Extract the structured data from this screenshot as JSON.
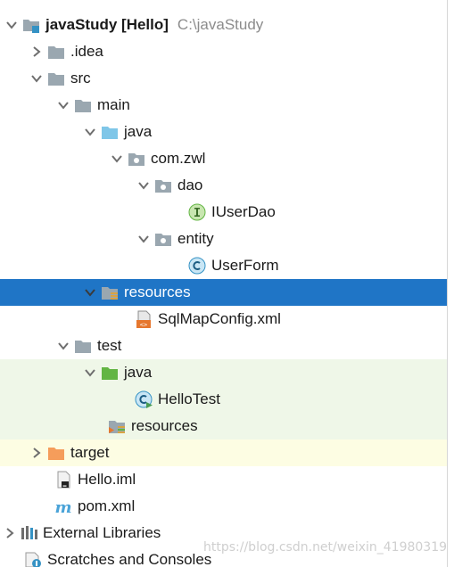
{
  "tree": {
    "rows": [
      {
        "label": "javaStudy [Hello]",
        "secondary": "C:\\javaStudy",
        "expanded": true,
        "icon": "module-folder-icon"
      },
      {
        "label": ".idea",
        "expanded": false,
        "icon": "folder-icon"
      },
      {
        "label": "src",
        "expanded": true,
        "icon": "folder-icon"
      },
      {
        "label": "main",
        "expanded": true,
        "icon": "folder-icon"
      },
      {
        "label": "java",
        "expanded": true,
        "icon": "source-root-folder-icon"
      },
      {
        "label": "com.zwl",
        "expanded": true,
        "icon": "package-icon"
      },
      {
        "label": "dao",
        "expanded": true,
        "icon": "package-icon"
      },
      {
        "label": "IUserDao",
        "icon": "interface-icon"
      },
      {
        "label": "entity",
        "expanded": true,
        "icon": "package-icon"
      },
      {
        "label": "UserForm",
        "icon": "class-icon"
      },
      {
        "label": "resources",
        "expanded": true,
        "selected": true,
        "icon": "resources-folder-icon"
      },
      {
        "label": "SqlMapConfig.xml",
        "icon": "xml-file-icon"
      },
      {
        "label": "test",
        "expanded": true,
        "icon": "folder-icon"
      },
      {
        "label": "java",
        "expanded": true,
        "icon": "test-source-folder-icon"
      },
      {
        "label": "HelloTest",
        "icon": "test-class-icon"
      },
      {
        "label": "resources",
        "icon": "test-resources-folder-icon"
      },
      {
        "label": "target",
        "expanded": false,
        "icon": "excluded-folder-icon"
      },
      {
        "label": "Hello.iml",
        "icon": "iml-file-icon"
      },
      {
        "label": "pom.xml",
        "icon": "maven-icon"
      },
      {
        "label": "External Libraries",
        "expanded": false,
        "icon": "libraries-icon"
      },
      {
        "label": "Scratches and Consoles",
        "icon": "scratches-icon"
      }
    ]
  },
  "watermark": "https://blog.csdn.net/weixin_41980319",
  "colors": {
    "selection": "#1f75c6",
    "test_background": "#eff7e8",
    "excluded_background": "#fdfde3",
    "folder": "#9aa7b0",
    "source_folder": "#7fc6e8",
    "test_folder": "#62b543",
    "excluded_folder": "#f59d5b"
  }
}
